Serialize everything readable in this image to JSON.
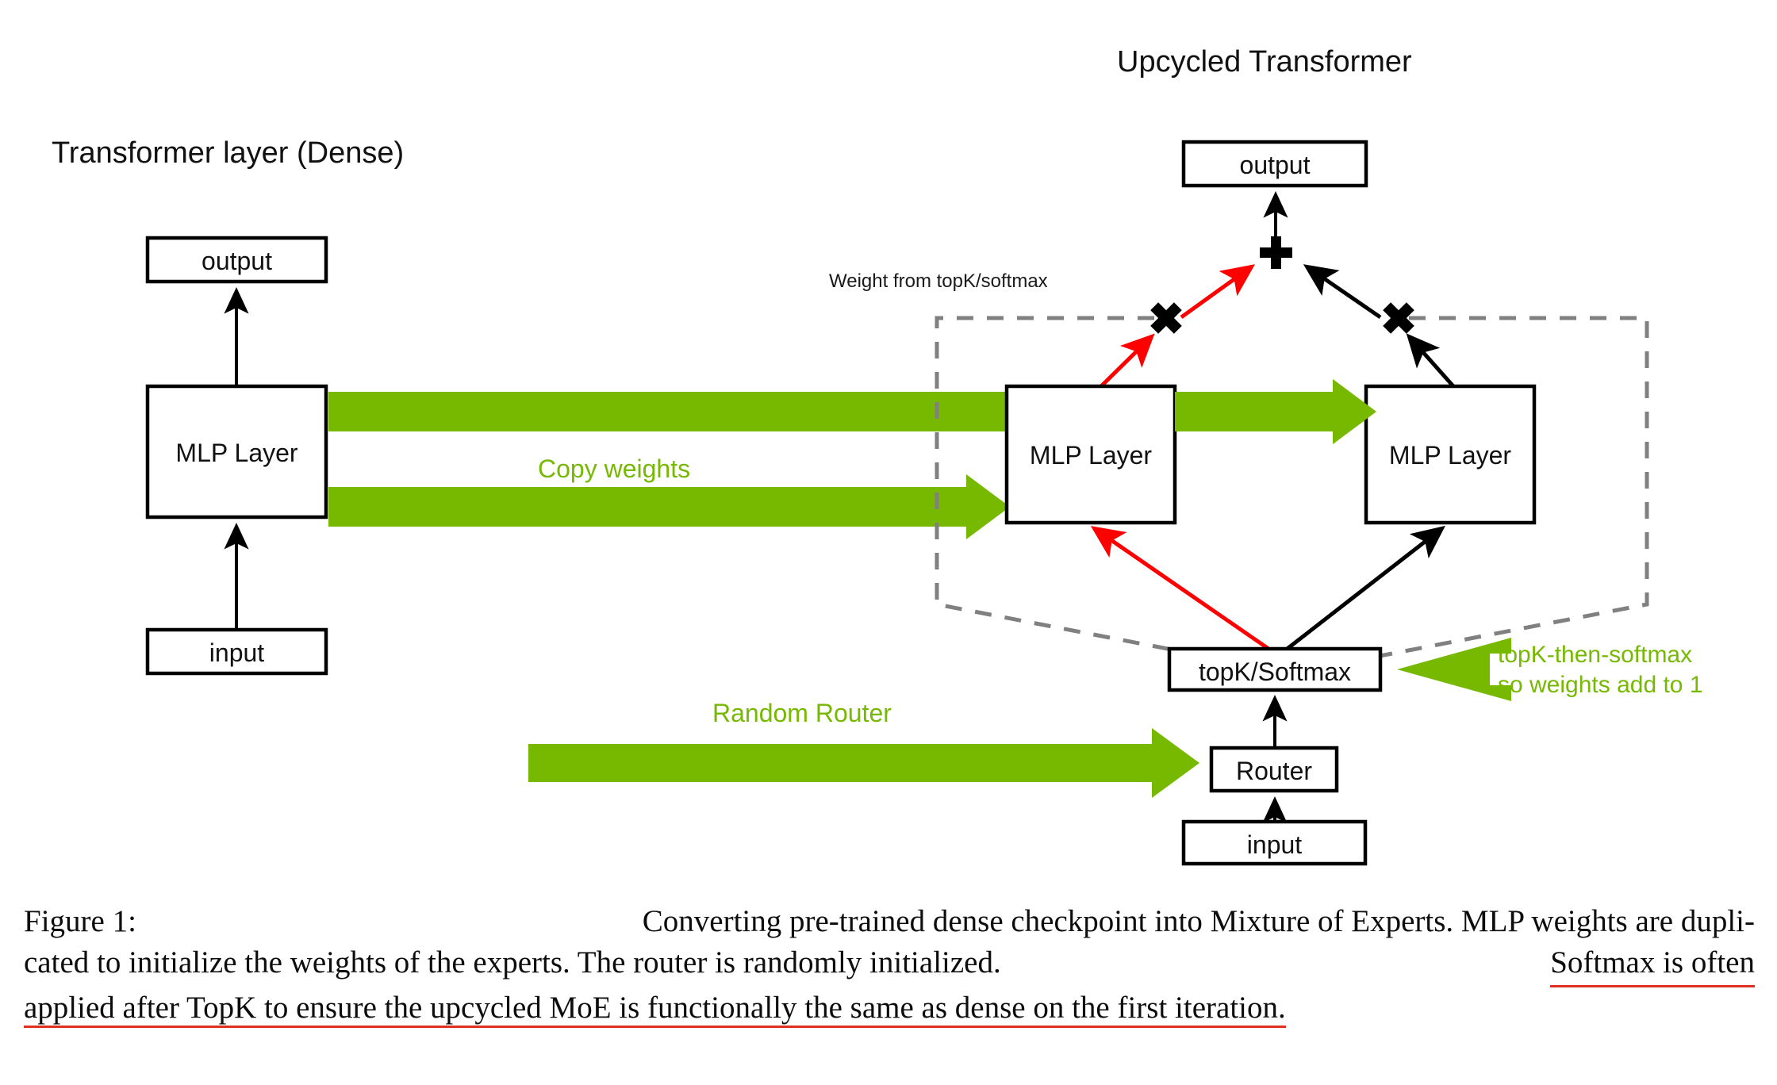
{
  "figure": {
    "left_panel": {
      "title": "Transformer layer (Dense)",
      "output_box": "output",
      "mlp_box": "MLP Layer",
      "input_box": "input"
    },
    "right_panel": {
      "title": "Upcycled Transformer",
      "output_box": "output",
      "expert_box_1": "MLP Layer",
      "expert_box_2": "MLP Layer",
      "topk_box": "topK/Softmax",
      "router_box": "Router",
      "input_box": "input",
      "weight_note": "Weight from topK/softmax",
      "plus_symbol": "+",
      "multiply_symbol_left": "✖",
      "multiply_symbol_right": "✖"
    },
    "annotations": {
      "copy_weights": "Copy weights",
      "random_router": "Random Router",
      "topk_then_softmax_line1": "topK-then-softmax",
      "topk_then_softmax_line2": "so weights add to 1"
    },
    "colors": {
      "green": "#76b900",
      "red": "#ff0000",
      "caption_underline": "#e03020",
      "dashed_gray": "#808080",
      "black": "#000000"
    }
  },
  "caption": {
    "line1_a": "Figure 1:",
    "line1_b": "Converting pre-trained dense checkpoint into Mixture of Experts.  MLP weights are dupli-",
    "line2_a": "cated to initialize the weights of the experts.  The router is randomly initialized.",
    "line2_underlined": "Softmax is often",
    "line3_underlined": "applied after TopK to ensure the upcycled MoE is functionally the same as dense on the first iteration."
  }
}
